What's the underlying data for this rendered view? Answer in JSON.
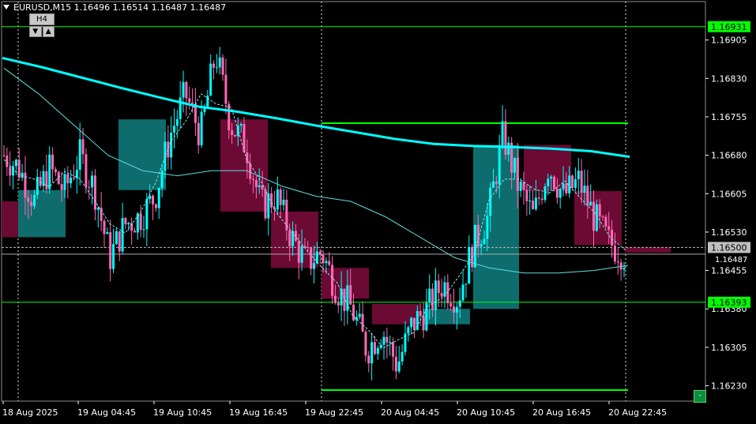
{
  "window": {
    "symbol": "EURUSD",
    "timeframe": "M15",
    "title_text": "EURUSD,M15  1.16496 1.16514 1.16487 1.16487",
    "higher_tf_label": "H4",
    "tf_down_glyph": "▼",
    "tf_up_glyph": "▲",
    "corner_button_glyph": "-"
  },
  "colors": {
    "background": "#000000",
    "bull_candle": "#00ffff",
    "bear_candle": "#ff69b4",
    "h4_bull_box": "#0e6c6c",
    "h4_bear_box": "#6b0a33",
    "ma_slow": "#00ffff",
    "level_line": "#00ff00",
    "label_green": "#00ff00",
    "price_label_bg": "#c0c0c0",
    "axis_text": "#ffffff"
  },
  "axis": {
    "price_ticks": [
      "1.16905",
      "1.16830",
      "1.16755",
      "1.16680",
      "1.16605",
      "1.16530",
      "1.16455",
      "1.16380",
      "1.16305",
      "1.16230"
    ],
    "time_ticks": [
      "18 Aug 2025",
      "19 Aug 04:45",
      "19 Aug 10:45",
      "19 Aug 16:45",
      "19 Aug 22:45",
      "20 Aug 04:45",
      "20 Aug 10:45",
      "20 Aug 16:45",
      "20 Aug 22:45"
    ]
  },
  "price_labels": {
    "upper_level": "1.16931",
    "lower_level": "1.16393",
    "current_price": "1.16500",
    "bid_price": "1.16487"
  },
  "chart_data": {
    "type": "candlestick",
    "symbol": "EURUSD",
    "timeframe": "M15",
    "ylim": [
      1.162,
      1.1698
    ],
    "last_bar": {
      "open": 1.16496,
      "high": 1.16514,
      "low": 1.16487,
      "close": 1.16487
    },
    "levels": [
      {
        "name": "upper",
        "value": 1.16931
      },
      {
        "name": "lower",
        "value": 1.16393
      }
    ],
    "day_separators": [
      "18 Aug 2025",
      "19 Aug 22:45",
      "20 Aug 22:45"
    ],
    "h4_boxes": [
      {
        "open": 1.1659,
        "close": 1.1652
      },
      {
        "open": 1.1652,
        "close": 1.16612
      },
      {
        "open": 1.16612,
        "close": 1.1675
      },
      {
        "open": 1.1675,
        "close": 1.1657
      },
      {
        "open": 1.1657,
        "close": 1.1646
      },
      {
        "open": 1.1646,
        "close": 1.164
      },
      {
        "open": 1.1639,
        "close": 1.1635
      },
      {
        "open": 1.1635,
        "close": 1.1638
      },
      {
        "open": 1.1638,
        "close": 1.167
      },
      {
        "open": 1.167,
        "close": 1.1661
      },
      {
        "open": 1.1661,
        "close": 1.16505
      },
      {
        "open": 1.165,
        "close": 1.1649
      }
    ],
    "ma_slow": [
      1.1687,
      1.16852,
      1.16832,
      1.16812,
      1.16793,
      1.16775,
      1.16765,
      1.16752,
      1.16738,
      1.16725,
      1.16712,
      1.16702,
      1.16698,
      1.16696,
      1.16693,
      1.16688,
      1.16677
    ],
    "ma_mid": [
      1.1685,
      1.168,
      1.1674,
      1.1668,
      1.1665,
      1.1664,
      1.1665,
      1.1665,
      1.1662,
      1.166,
      1.1659,
      1.1656,
      1.1652,
      1.1648,
      1.1646,
      1.1645,
      1.1645,
      1.16455,
      1.16465
    ],
    "price_path": [
      1.1668,
      1.16655,
      1.1659,
      1.16655,
      1.1661,
      1.1668,
      1.16612,
      1.1648,
      1.16545,
      1.1656,
      1.166,
      1.1672,
      1.168,
      1.1672,
      1.1688,
      1.1674,
      1.167,
      1.1658,
      1.166,
      1.1652,
      1.1647,
      1.1649,
      1.1642,
      1.1638,
      1.163,
      1.1634,
      1.1627,
      1.1635,
      1.1638,
      1.1643,
      1.164,
      1.165,
      1.1656,
      1.1672,
      1.1662,
      1.1656,
      1.1666,
      1.166,
      1.1663,
      1.1656,
      1.1651,
      1.16487
    ]
  }
}
